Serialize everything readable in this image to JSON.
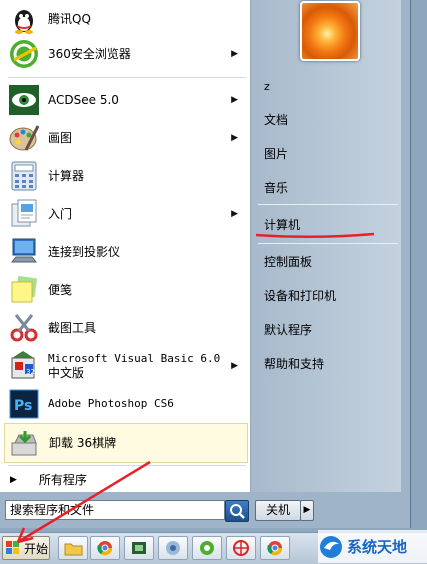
{
  "pinned": [
    {
      "label": "腾讯QQ",
      "icon": "qq-penguin-icon"
    },
    {
      "label": "360安全浏览器",
      "icon": "360-browser-icon",
      "has_submenu": true
    }
  ],
  "recent": [
    {
      "label": "ACDSee 5.0",
      "icon": "acdsee-icon",
      "has_submenu": true
    },
    {
      "label": "画图",
      "icon": "paint-icon",
      "has_submenu": true
    },
    {
      "label": "计算器",
      "icon": "calculator-icon"
    },
    {
      "label": "入门",
      "icon": "getting-started-icon",
      "has_submenu": true
    },
    {
      "label": "连接到投影仪",
      "icon": "projector-icon"
    },
    {
      "label": "便笺",
      "icon": "sticky-notes-icon"
    },
    {
      "label": "截图工具",
      "icon": "snipping-tool-icon"
    },
    {
      "label_line1": "Microsoft Visual Basic 6.0",
      "label_line2": "中文版",
      "icon": "vb6-icon",
      "has_submenu": true
    },
    {
      "label": "Adobe Photoshop CS6",
      "icon": "photoshop-icon"
    },
    {
      "label": "卸载 36棋牌",
      "icon": "uninstall-icon",
      "highlighted": true
    }
  ],
  "all_programs": "所有程序",
  "search": {
    "value": "搜索程序和文件"
  },
  "right_panel": {
    "user_name": "z",
    "items": [
      "文档",
      "图片",
      "音乐",
      "计算机",
      "控制面板",
      "设备和打印机",
      "默认程序",
      "帮助和支持"
    ]
  },
  "shutdown": {
    "label": "关机"
  },
  "taskbar": {
    "start_label": "开始"
  },
  "watermark": {
    "text": "系统天地"
  },
  "colors": {
    "highlight_bg": "#fffbe0",
    "annotation_red": "#e8202a"
  }
}
